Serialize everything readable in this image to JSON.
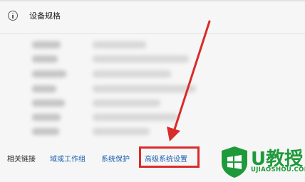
{
  "section": {
    "title": "设备规格"
  },
  "related": {
    "label": "相关链接",
    "links": [
      "域或工作组",
      "系统保护",
      "高级系统设置"
    ]
  },
  "annotation": {
    "color": "#d92b2b",
    "highlighted_link": "高级系统设置"
  },
  "watermark": {
    "brand": "U教授",
    "url": "UJIAOSHOU.COM",
    "color": "#1f9a3a"
  },
  "icons": [
    "info-icon",
    "windows-logo-icon"
  ]
}
